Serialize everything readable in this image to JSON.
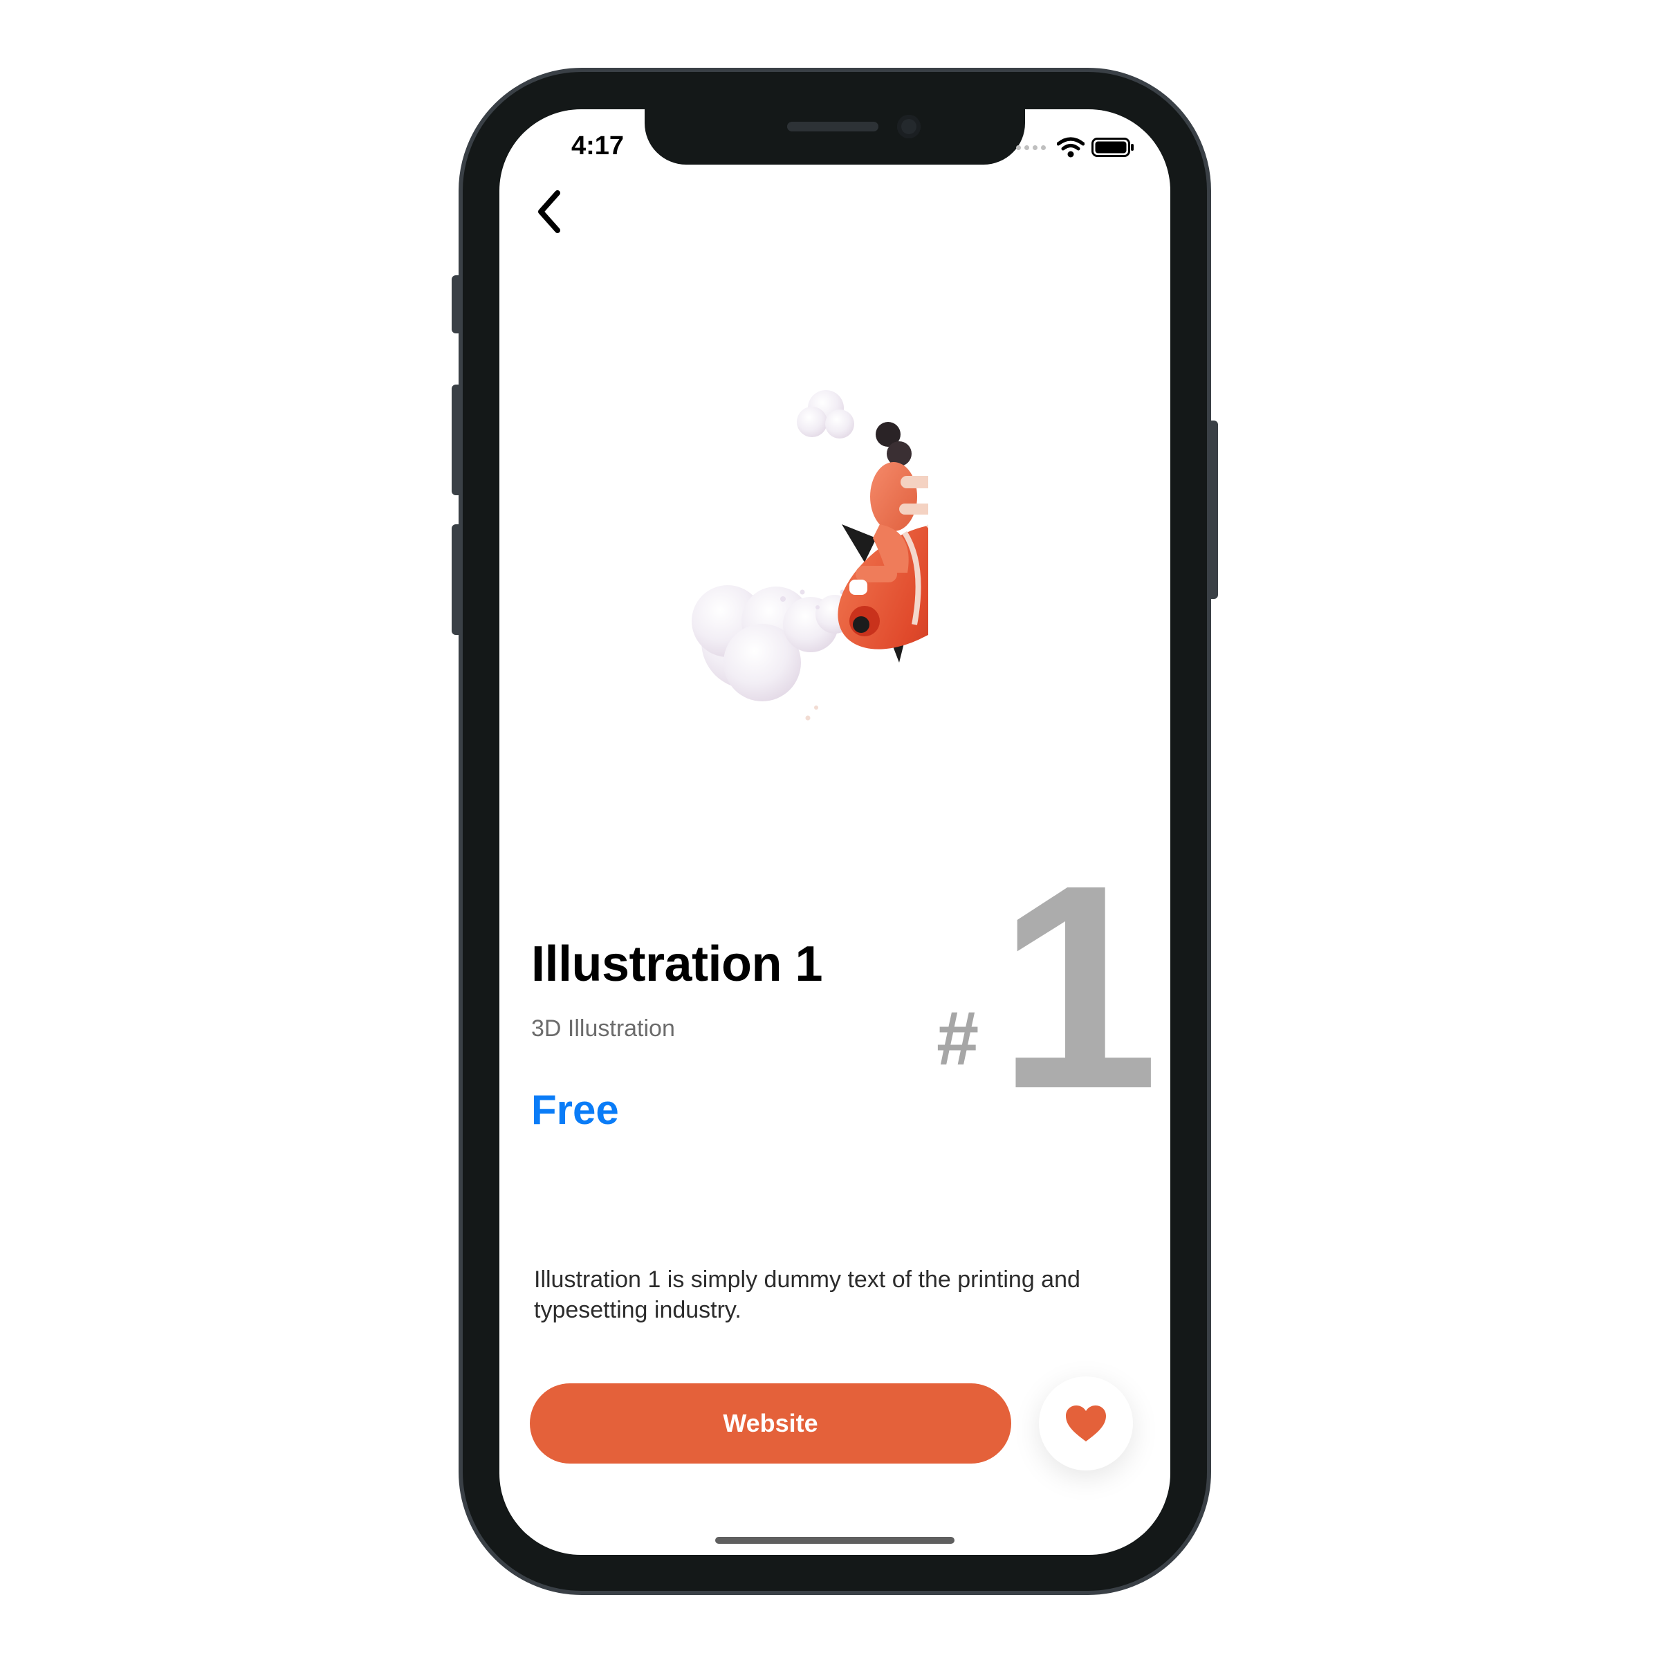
{
  "status_bar": {
    "time": "4:17",
    "icons": [
      "signal-icon",
      "wifi-icon",
      "battery-icon"
    ]
  },
  "nav": {
    "back_icon": "chevron-left-icon"
  },
  "product": {
    "title": "Illustration 1",
    "category": "3D Illustration",
    "price": "Free",
    "rank_symbol": "#",
    "rank_number": "1",
    "description": "Illustration 1 is simply dummy text of the printing and typesetting industry."
  },
  "actions": {
    "website_label": "Website",
    "favorite_icon": "heart-icon"
  },
  "colors": {
    "accent": "#e4613a",
    "price": "#0a7cf7",
    "rank": "#acacac",
    "frame": "#141818"
  }
}
